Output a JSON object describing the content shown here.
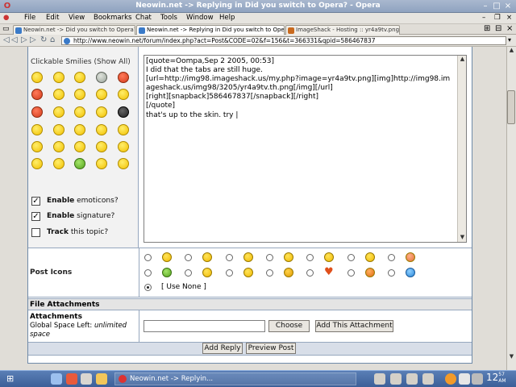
{
  "window": {
    "title": "Neowin.net -> Replying in Did you switch to Opera? - Opera"
  },
  "menu": [
    "File",
    "Edit",
    "View",
    "Bookmarks",
    "Chat",
    "Tools",
    "Window",
    "Help"
  ],
  "tabs": [
    {
      "label": "Neowin.net -> Did you switch to Opera?",
      "active": false
    },
    {
      "label": "Neowin.net -> Replying in Did you switch to Ope...",
      "active": true
    },
    {
      "label": "ImageShack - Hosting :: yr4a9tv.png",
      "active": false
    }
  ],
  "address": {
    "url": "http://www.neowin.net/forum/index.php?act=Post&CODE=02&f=156&t=366331&qpid=586467837"
  },
  "form": {
    "smilies_title": "Clickable Smilies (Show All)",
    "options": [
      {
        "bold": "Enable",
        "rest": " emoticons?",
        "checked": true
      },
      {
        "bold": "Enable",
        "rest": " signature?",
        "checked": true
      },
      {
        "bold": "Track",
        "rest": " this topic?",
        "checked": false
      }
    ],
    "message": "[quote=Oompa,Sep 2 2005, 00:53]\nI did that the tabs are still huge.\n[url=http://img98.imageshack.us/my.php?image=yr4a9tv.png][img]http://img98.imageshack.us/img98/3205/yr4a9tv.th.png[/img][/url]\n[right][snapback]586467837[/snapback][/right]\n[/quote]\nthat's up to the skin. try |",
    "post_icons_label": "Post Icons",
    "use_none": "[ Use None ]",
    "file_attachments_heading": "File Attachments",
    "attachments_label": "Attachments",
    "global_space_prefix": "Global Space Left: ",
    "global_space_value": "unlimited space",
    "choose_button": "Choose",
    "add_attachment_button": "Add This Attachment",
    "add_reply_button": "Add Reply",
    "preview_button": "Preview Post"
  },
  "taskbar": {
    "task_label": "Neowin.net -> Replyin...",
    "clock_hour": "12",
    "clock_min": "57",
    "clock_ampm": "AM"
  },
  "colors": {
    "titlebar": "#8fa3c0",
    "taskbar": "#3c5f98",
    "border": "#96a7be"
  }
}
